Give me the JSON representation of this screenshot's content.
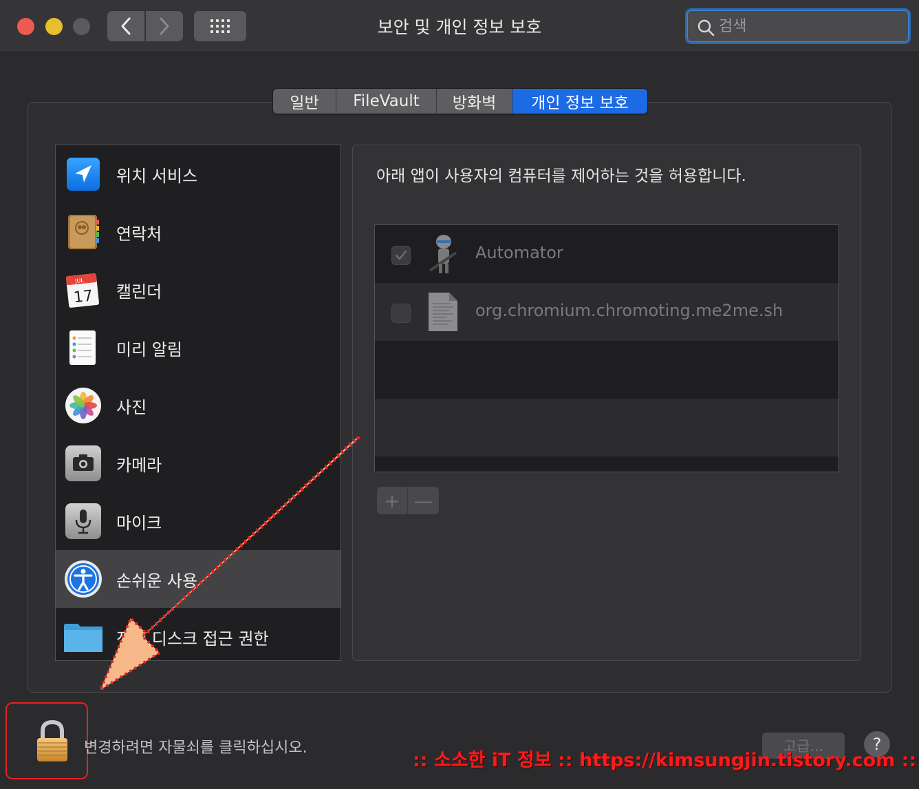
{
  "window": {
    "title": "보안 및 개인 정보 보호",
    "search_placeholder": "검색"
  },
  "tabs": [
    {
      "label": "일반",
      "active": false
    },
    {
      "label": "FileVault",
      "active": false
    },
    {
      "label": "방화벽",
      "active": false
    },
    {
      "label": "개인 정보 보호",
      "active": true
    }
  ],
  "sidebar": {
    "items": [
      {
        "label": "위치 서비스",
        "icon": "location-arrow-icon"
      },
      {
        "label": "연락처",
        "icon": "contacts-book-icon"
      },
      {
        "label": "캘린더",
        "icon": "calendar-icon",
        "month": "JUL",
        "day": "17"
      },
      {
        "label": "미리 알림",
        "icon": "reminders-icon"
      },
      {
        "label": "사진",
        "icon": "photos-icon"
      },
      {
        "label": "카메라",
        "icon": "camera-icon"
      },
      {
        "label": "마이크",
        "icon": "microphone-icon"
      },
      {
        "label": "손쉬운 사용",
        "icon": "accessibility-icon",
        "selected": true
      },
      {
        "label": "전체 디스크 접근 권한",
        "icon": "folder-icon"
      }
    ]
  },
  "main": {
    "description": "아래 앱이 사용자의 컴퓨터를 제어하는 것을 허용합니다.",
    "apps": [
      {
        "name": "Automator",
        "checked": true,
        "icon": "automator-robot-icon"
      },
      {
        "name": "org.chromium.chromoting.me2me.sh",
        "checked": false,
        "icon": "document-icon"
      }
    ],
    "add_label": "+",
    "remove_label": "—"
  },
  "footer": {
    "lock_text": "변경하려면 자물쇠를 클릭하십시오.",
    "advanced_label": "고급...",
    "help_label": "?"
  },
  "watermark": ":: 소소한 iT 정보 :: https://kimsungjin.tistory.com ::",
  "colors": {
    "accent": "#1c6ae4",
    "annotation_red": "#e32222",
    "arrow_fill": "#f7b98a"
  }
}
